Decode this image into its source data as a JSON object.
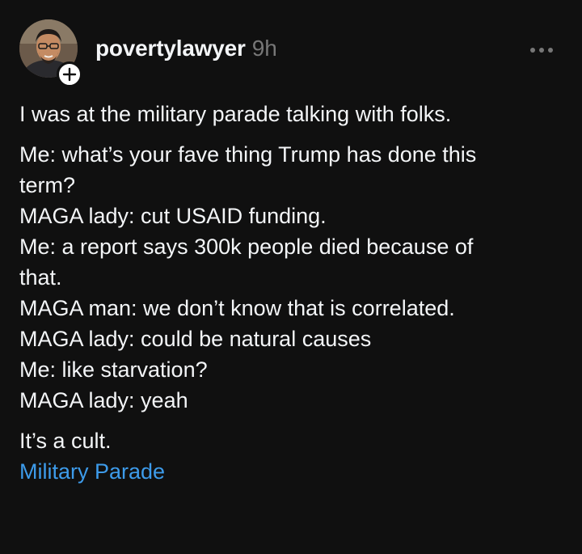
{
  "post": {
    "username": "povertylawyer",
    "timestamp": "9h",
    "follow_symbol": "+",
    "more_symbol": "•••",
    "paragraphs": [
      [
        "I was at the military parade talking with folks."
      ],
      [
        "Me: what’s your fave thing Trump has done this",
        "term?",
        "MAGA lady: cut USAID funding.",
        "Me: a report says 300k people died because of",
        "that.",
        "MAGA man: we don’t know that is correlated.",
        "MAGA lady: could be natural causes",
        "Me: like starvation?",
        "MAGA lady: yeah"
      ],
      [
        "It’s a cult."
      ]
    ],
    "topic_tag": "Military Parade"
  },
  "colors": {
    "background": "#101010",
    "text_primary": "#f3f5f7",
    "text_secondary": "#777777",
    "link": "#3d9bea"
  },
  "icons": {
    "avatar": "profile-photo",
    "follow": "plus-icon",
    "more": "more-horizontal-icon"
  }
}
